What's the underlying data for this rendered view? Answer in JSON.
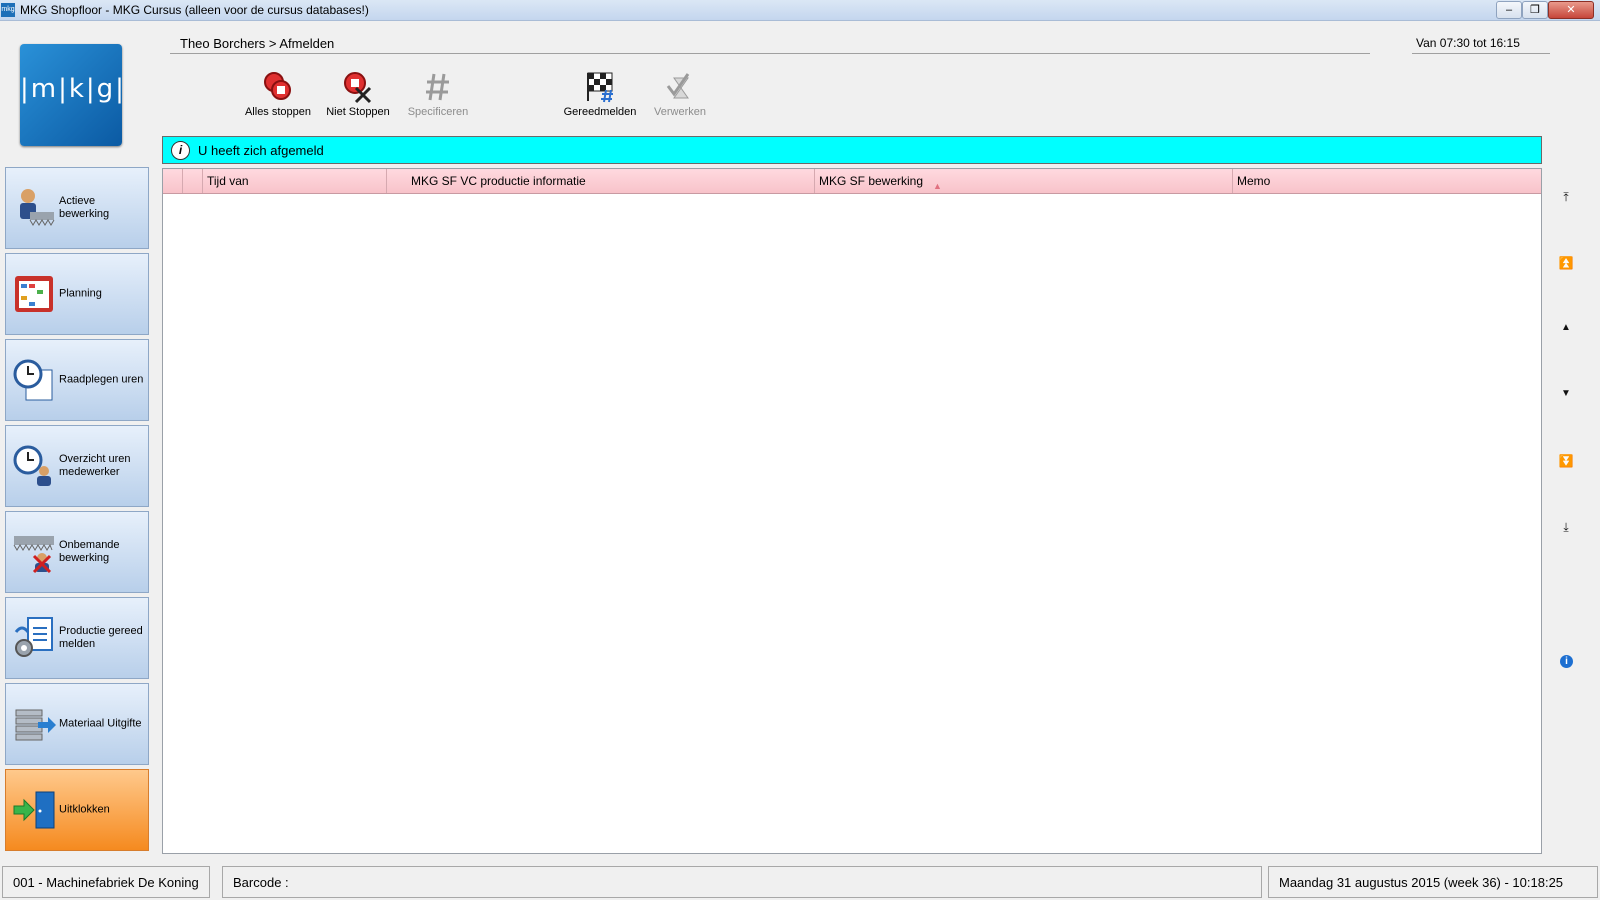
{
  "window": {
    "title": "MKG Shopfloor - MKG Cursus (alleen voor de cursus databases!)",
    "app_icon_text": "mkg",
    "minimize": "–",
    "maximize": "❐",
    "close": "✕"
  },
  "logo": {
    "text": "|m|k|g|"
  },
  "sidebar": {
    "items": [
      {
        "label": "Actieve bewerking",
        "icon": "worker-saw-icon"
      },
      {
        "label": "Planning",
        "icon": "planning-calendar-icon"
      },
      {
        "label": "Raadplegen uren",
        "icon": "clock-document-icon"
      },
      {
        "label": "Overzicht uren medewerker",
        "icon": "clock-person-icon"
      },
      {
        "label": "Onbemande bewerking",
        "icon": "saw-crossed-person-icon"
      },
      {
        "label": "Productie gereed melden",
        "icon": "gear-document-icon"
      },
      {
        "label": "Materiaal Uitgifte",
        "icon": "stack-arrow-icon"
      },
      {
        "label": "Uitklokken",
        "icon": "door-exit-icon",
        "active": true
      }
    ]
  },
  "header": {
    "breadcrumb": "Theo Borchers > Afmelden",
    "time_range": "Van 07:30 tot 16:15"
  },
  "toolbar": {
    "alles_stoppen": "Alles stoppen",
    "niet_stoppen": "Niet Stoppen",
    "specificeren": "Specificeren",
    "gereedmelden": "Gereedmelden",
    "verwerken": "Verwerken"
  },
  "info": {
    "message": "U heeft zich afgemeld"
  },
  "grid": {
    "columns": [
      "Tijd van",
      "MKG SF VC productie informatie",
      "MKG SF bewerking",
      "Memo"
    ],
    "sort_indicator": "▲",
    "rows": []
  },
  "scroll": {
    "first": "⤒",
    "page_up": "⏫",
    "up": "▲",
    "down": "▼",
    "page_down": "⏬",
    "last": "⤓",
    "info": "i"
  },
  "statusbar": {
    "company": "001 - Machinefabriek De Koning",
    "barcode_label": "Barcode :",
    "datetime": "Maandag 31 augustus 2015 (week 36)  -  10:18:25"
  },
  "colors": {
    "info_bar": "#00ffff",
    "active_nav": "#f58a1f",
    "grid_header": "#f8c3ca"
  }
}
